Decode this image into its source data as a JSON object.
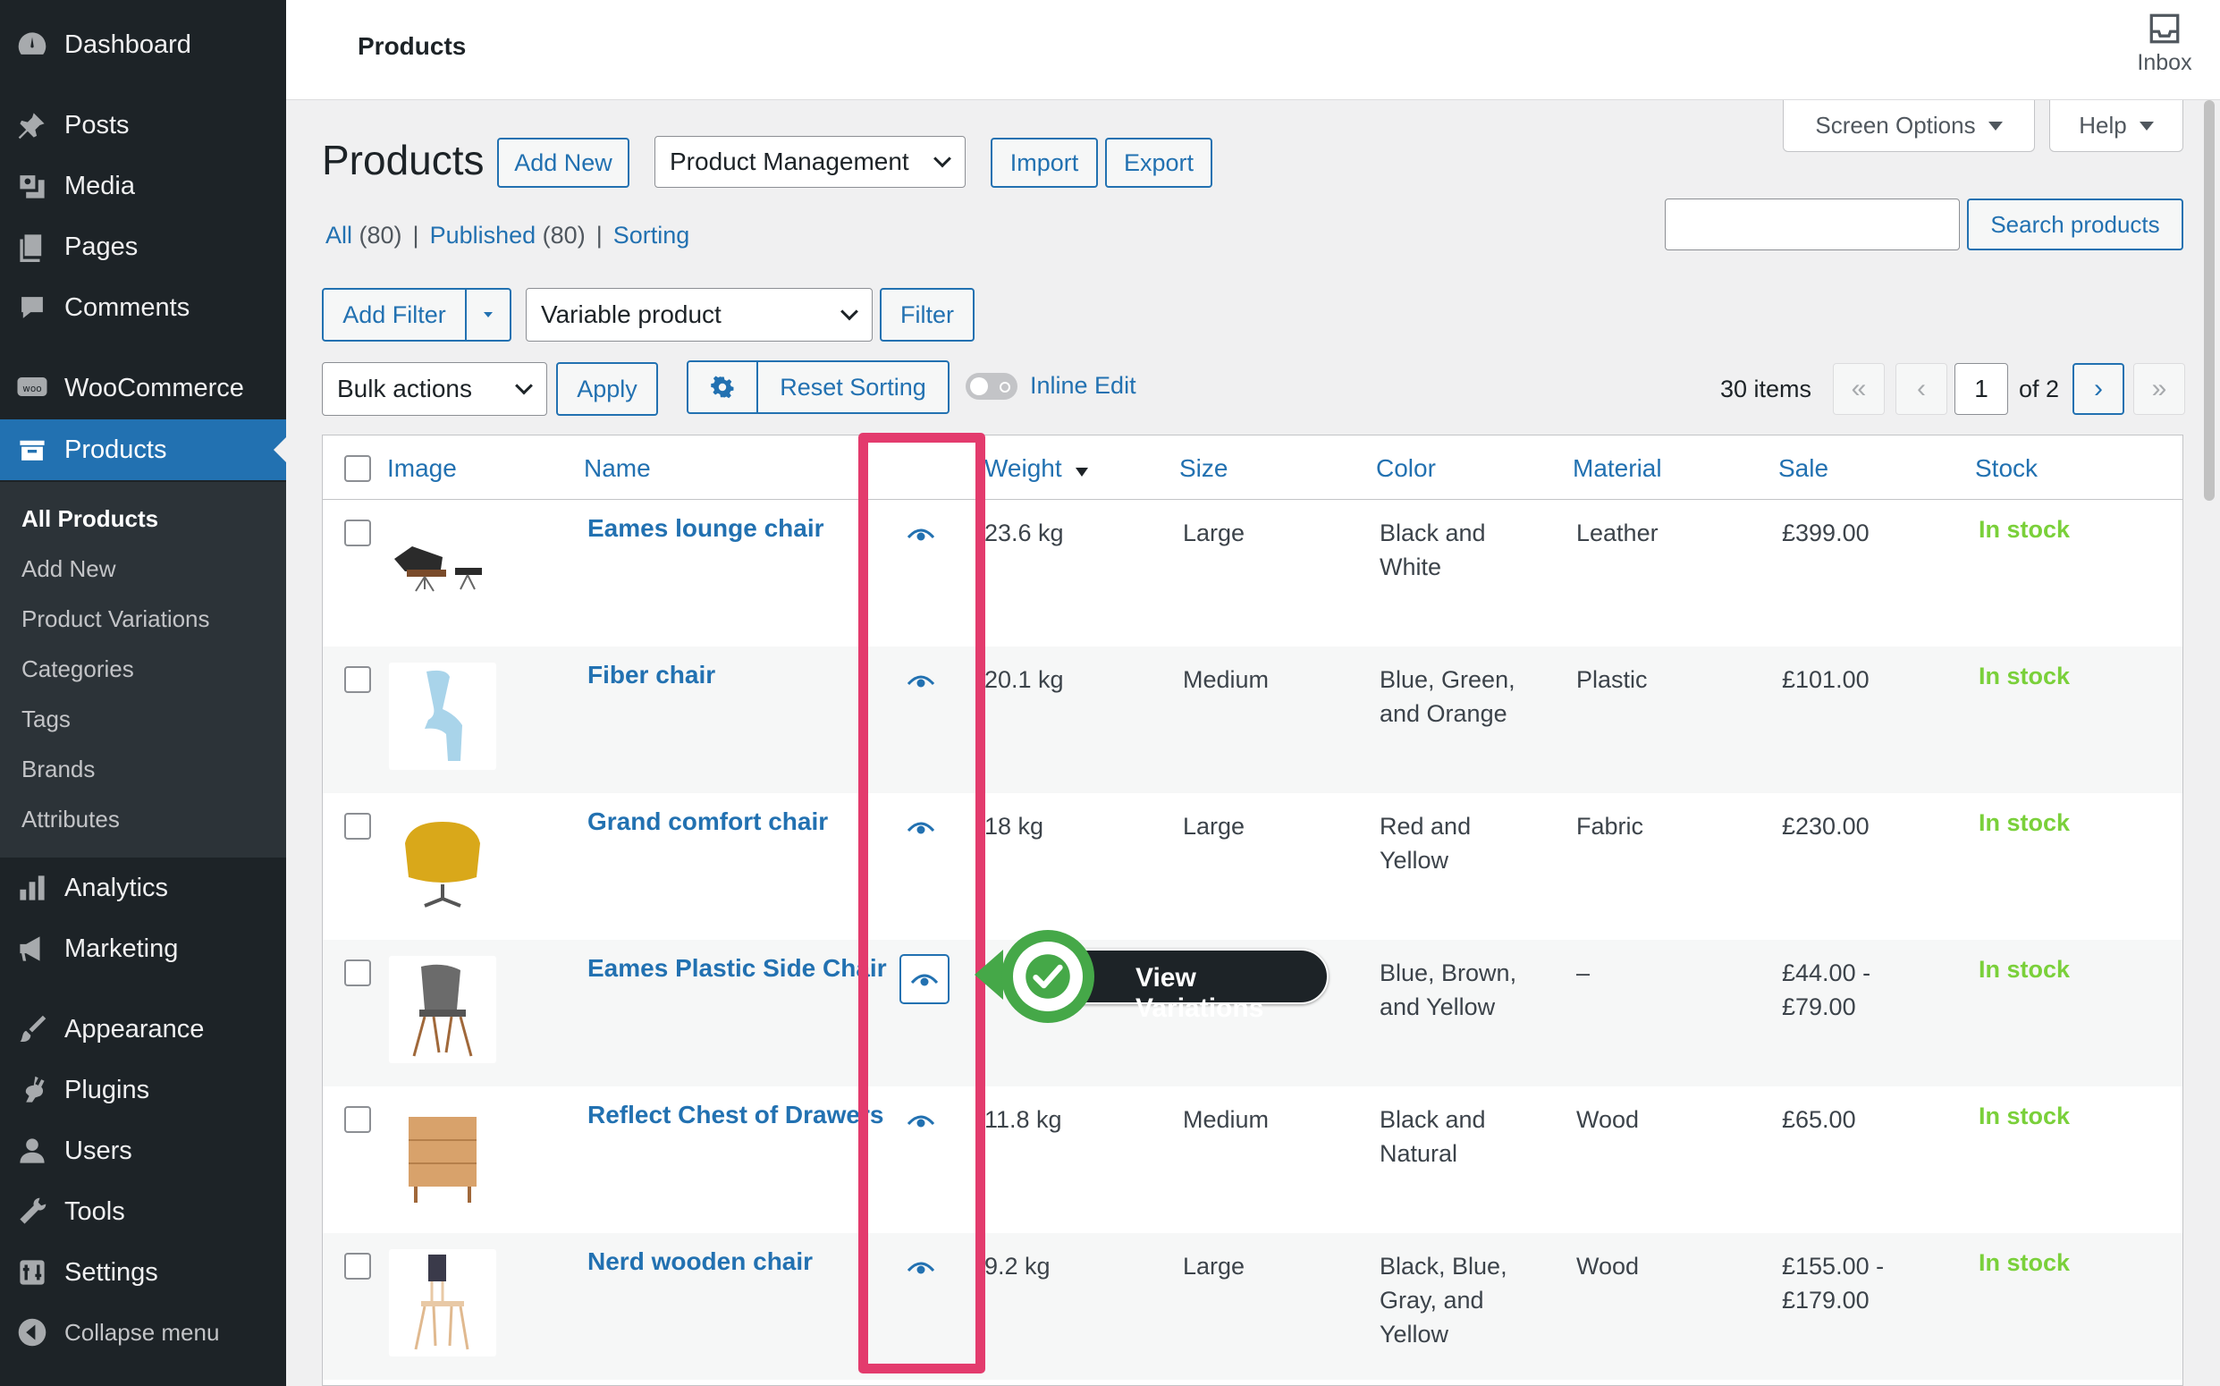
{
  "sidebar": {
    "items": [
      {
        "label": "Dashboard",
        "icon": "dashboard-icon"
      },
      {
        "label": "Posts",
        "icon": "pin-icon"
      },
      {
        "label": "Media",
        "icon": "media-icon"
      },
      {
        "label": "Pages",
        "icon": "pages-icon"
      },
      {
        "label": "Comments",
        "icon": "comment-icon"
      },
      {
        "label": "WooCommerce",
        "icon": "woo-icon"
      },
      {
        "label": "Products",
        "icon": "products-icon"
      },
      {
        "label": "Analytics",
        "icon": "bar-chart-icon"
      },
      {
        "label": "Marketing",
        "icon": "megaphone-icon"
      },
      {
        "label": "Appearance",
        "icon": "brush-icon"
      },
      {
        "label": "Plugins",
        "icon": "plug-icon"
      },
      {
        "label": "Users",
        "icon": "user-icon"
      },
      {
        "label": "Tools",
        "icon": "wrench-icon"
      },
      {
        "label": "Settings",
        "icon": "settings-icon"
      },
      {
        "label": "Collapse menu",
        "icon": "collapse-icon"
      }
    ],
    "submenu": [
      "All Products",
      "Add New",
      "Product Variations",
      "Categories",
      "Tags",
      "Brands",
      "Attributes"
    ]
  },
  "topbar": {
    "title": "Products",
    "inbox": "Inbox"
  },
  "screen_options": "Screen Options",
  "help": "Help",
  "page": {
    "title": "Products",
    "add_new": "Add New",
    "mgmt_select": "Product Management",
    "import": "Import",
    "export": "Export"
  },
  "views": {
    "all": "All",
    "all_count": "(80)",
    "sep": "|",
    "published": "Published",
    "published_count": "(80)",
    "sorting": "Sorting"
  },
  "search_button": "Search products",
  "filter": {
    "add_filter": "Add Filter",
    "type_select": "Variable product",
    "filter_button": "Filter"
  },
  "bulk": {
    "select": "Bulk actions",
    "apply": "Apply",
    "reset_sorting": "Reset Sorting",
    "inline_edit": "Inline Edit"
  },
  "pagination": {
    "items": "30 items",
    "first": "«",
    "prev": "‹",
    "current": "1",
    "of": "of 2",
    "next": "›",
    "last": "»"
  },
  "columns": [
    "Image",
    "Name",
    "Weight",
    "Size",
    "Color",
    "Material",
    "Sale",
    "Stock"
  ],
  "rows": [
    {
      "name": "Eames lounge chair",
      "weight": "23.6 kg",
      "size": "Large",
      "color": [
        "Black and",
        "White"
      ],
      "material": "Leather",
      "sale": [
        "£399.00"
      ],
      "stock": "In stock"
    },
    {
      "name": "Fiber chair",
      "weight": "20.1 kg",
      "size": "Medium",
      "color": [
        "Blue, Green,",
        "and Orange"
      ],
      "material": "Plastic",
      "sale": [
        "£101.00"
      ],
      "stock": "In stock"
    },
    {
      "name": "Grand comfort chair",
      "weight": "18 kg",
      "size": "Large",
      "color": [
        "Red and",
        "Yellow"
      ],
      "material": "Fabric",
      "sale": [
        "£230.00"
      ],
      "stock": "In stock"
    },
    {
      "name": "Eames Plastic Side Chair",
      "weight": "",
      "size": "",
      "color": [
        "Blue, Brown,",
        "and Yellow"
      ],
      "material": "–",
      "sale": [
        "£44.00 -",
        "£79.00"
      ],
      "stock": "In stock"
    },
    {
      "name": "Reflect Chest of Drawers",
      "weight": "11.8 kg",
      "size": "Medium",
      "color": [
        "Black and",
        "Natural"
      ],
      "material": "Wood",
      "sale": [
        "£65.00"
      ],
      "stock": "In stock"
    },
    {
      "name": "Nerd wooden chair",
      "weight": "9.2 kg",
      "size": "Large",
      "color": [
        "Black, Blue,",
        "Gray, and",
        "Yellow"
      ],
      "material": "Wood",
      "sale": [
        "£155.00 -",
        "£179.00"
      ],
      "stock": "In stock"
    }
  ],
  "callout": "View Variations",
  "colors": {
    "accent": "#2271b1",
    "sidebar": "#1d2327",
    "highlight": "#e33b6d",
    "callout_green": "#45a848",
    "stock": "#7ad03a"
  }
}
